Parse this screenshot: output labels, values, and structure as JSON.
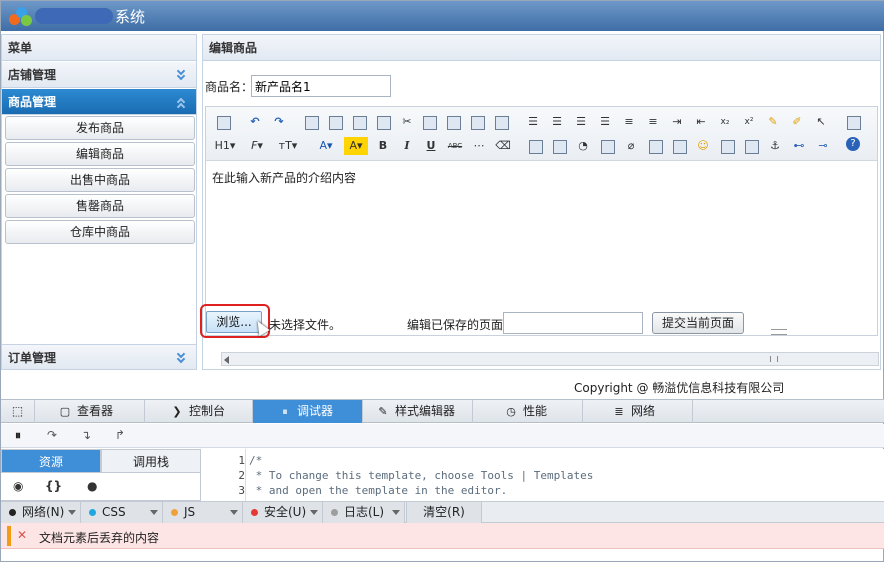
{
  "titlebar": {
    "title": "系统"
  },
  "sidebar": {
    "menu_header": "菜单",
    "groups": [
      {
        "label": "店铺管理"
      },
      {
        "label": "商品管理"
      },
      {
        "label": "订单管理"
      }
    ],
    "items": [
      "发布商品",
      "编辑商品",
      "出售中商品",
      "售罄商品",
      "仓库中商品"
    ]
  },
  "main": {
    "header": "编辑商品",
    "name_label": "商品名：",
    "name_value": "新产品名1",
    "editor_toolbar_row2": {
      "heading": "H1",
      "font": "F",
      "size": "тT",
      "bold": "B",
      "italic": "I",
      "underline": "U",
      "strike": "ABC"
    },
    "editor_content": "在此输入新产品的介绍内容",
    "browse_label": "浏览...",
    "no_file": "未选择文件。",
    "saved_label": "编辑已保存的页面",
    "submit_label": "提交当前页面"
  },
  "footer": {
    "copyright": "Copyright @ 畅溢优信息科技有限公司"
  },
  "devtools": {
    "tabs": [
      "查看器",
      "控制台",
      "调试器",
      "样式编辑器",
      "性能",
      "网络"
    ],
    "source_tabs": [
      "资源",
      "调用栈"
    ],
    "code_lines": [
      {
        "n": "1",
        "t": "/*"
      },
      {
        "n": "2",
        "t": " * To change this template, choose Tools | Templates"
      },
      {
        "n": "3",
        "t": " * and open the template in the editor."
      }
    ],
    "filters": [
      {
        "label": "网络(N)",
        "color": "#222222"
      },
      {
        "label": "CSS",
        "color": "#1fa7e0"
      },
      {
        "label": "JS",
        "color": "#f0a23a"
      },
      {
        "label": "安全(U)",
        "color": "#e53935"
      },
      {
        "label": "日志(L)",
        "color": "#9e9e9e"
      }
    ],
    "clear_label": "清空(R)",
    "console_message": "文档元素后丢弃的内容"
  }
}
